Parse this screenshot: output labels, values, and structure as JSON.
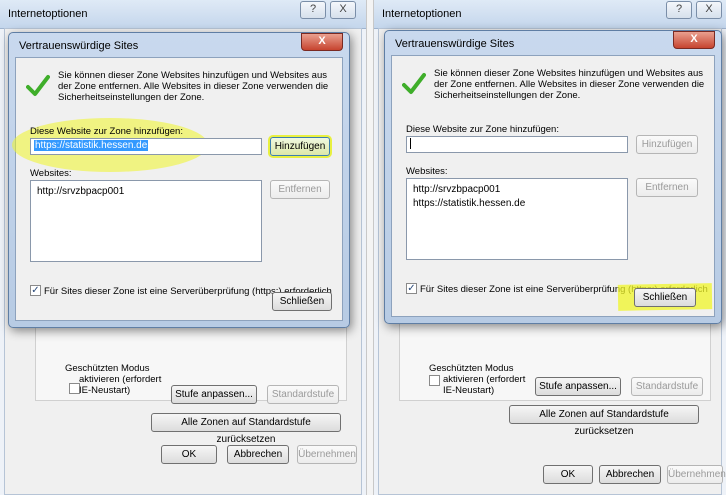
{
  "outer": {
    "title": "Internetoptionen",
    "help_btn": "?",
    "close_btn": "X",
    "protected_mode": "Geschützten Modus aktivieren (erfordert IE-Neustart)",
    "protected_mode_lines": [
      "Geschützten Modus",
      "aktivieren (erfordert",
      "IE-Neustart)"
    ],
    "custom_level_btn": "Stufe anpassen...",
    "default_level_btn": "Standardstufe",
    "reset_all_btn": "Alle Zonen auf Standardstufe zurücksetzen",
    "ok_btn": "OK",
    "cancel_btn": "Abbrechen",
    "apply_btn": "Übernehmen"
  },
  "dialog": {
    "title": "Vertrauenswürdige Sites",
    "close_btn": "X",
    "intro": "Sie können dieser Zone Websites hinzufügen und Websites aus der Zone entfernen. Alle Websites in dieser Zone verwenden die Sicherheitseinstellungen der Zone.",
    "intro_lines": [
      "Sie können dieser Zone Websites hinzufügen und Websites aus",
      "der Zone entfernen. Alle Websites in dieser Zone verwenden die",
      "Sicherheitseinstellungen der Zone."
    ],
    "add_label": "Diese Website zur Zone hinzufügen:",
    "add_btn": "Hinzufügen",
    "websites_label": "Websites:",
    "remove_btn": "Entfernen",
    "https_checkbox": "Für Sites dieser Zone ist eine Serverüberprüfung (https:) erforderlich",
    "close_dialog_btn": "Schließen"
  },
  "left": {
    "input_value": "https://statistik.hessen.de",
    "websites": [
      "http://srvzbpacp001"
    ]
  },
  "right": {
    "input_value": "",
    "websites": [
      "http://srvzbpacp001",
      "https://statistik.hessen.de"
    ]
  },
  "colors": {
    "highlight": "#f0f528",
    "accent": "#3399ff",
    "checkmark": "#3fae2a"
  }
}
